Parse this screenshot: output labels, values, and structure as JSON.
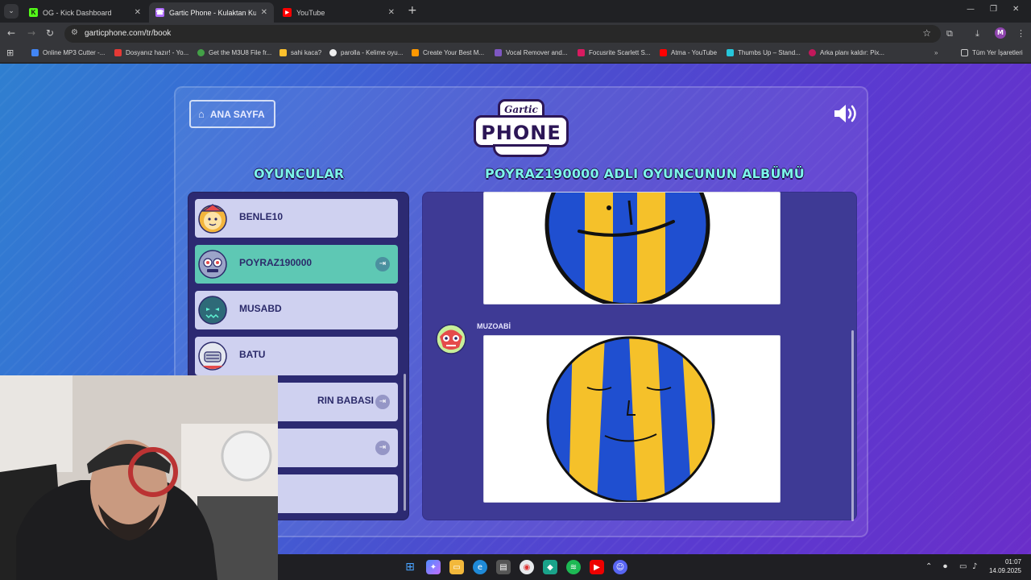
{
  "browser": {
    "tabs": [
      {
        "title": "OG - Kick Dashboard",
        "fav_color": "#53fc18",
        "fav_glyph": "K",
        "active": false
      },
      {
        "title": "Gartic Phone - Kulaktan Kulağa",
        "fav_color": "#b06cff",
        "fav_glyph": "☎",
        "active": true
      },
      {
        "title": "YouTube",
        "fav_color": "#ff0000",
        "fav_glyph": "▶",
        "active": false
      }
    ],
    "url": "garticphone.com/tr/book",
    "bookmarks": [
      {
        "label": "Online MP3 Cutter -...",
        "color": "#4285f4"
      },
      {
        "label": "Dosyanız hazır! - Yo...",
        "color": "#e53935"
      },
      {
        "label": "Get the M3U8 File fr...",
        "color": "#43a047"
      },
      {
        "label": "sahi kaca?",
        "color": "#fbc02d"
      },
      {
        "label": "parolla - Kelime oyu...",
        "color": "#eeeeee"
      },
      {
        "label": "Create Your Best M...",
        "color": "#ff9800"
      },
      {
        "label": "Vocal Remover and...",
        "color": "#7e57c2"
      },
      {
        "label": "Focusrite Scarlett S...",
        "color": "#d81b60"
      },
      {
        "label": "Atma - YouTube",
        "color": "#ff0000"
      },
      {
        "label": "Thumbs Up – Stand...",
        "color": "#26c6da"
      },
      {
        "label": "Arka planı kaldır: Pix...",
        "color": "#c2185b"
      }
    ],
    "all_bookmarks_label": "Tüm Yer İşaretleri",
    "profile_initial": "M"
  },
  "game": {
    "home_button": "ANA SAYFA",
    "logo_top": "Gartic",
    "logo_main": "PHONE",
    "players_heading": "OYUNCULAR",
    "album_heading": "POYRAZ190000 ADLI OYUNCUNUN ALBÜMÜ",
    "players": [
      {
        "name": "BENLE10",
        "active": false,
        "avatar": "lion"
      },
      {
        "name": "POYRAZ190000",
        "active": true,
        "avatar": "robot"
      },
      {
        "name": "MUSABD",
        "active": false,
        "avatar": "ghost"
      },
      {
        "name": "BATU",
        "active": false,
        "avatar": "knight"
      },
      {
        "name": "RIN BABASI",
        "active": false,
        "avatar": "hidden"
      },
      {
        "name": "",
        "active": false,
        "avatar": "hidden"
      },
      {
        "name": "",
        "active": false,
        "avatar": "hidden"
      }
    ],
    "album_author": "MUZOABİ",
    "accent_color": "#7cf5e9",
    "drawing_colors": {
      "blue": "#1f4fd0",
      "yellow": "#f5c12a"
    }
  },
  "taskbar": {
    "time": "01:07",
    "date": "14.09.2025"
  }
}
